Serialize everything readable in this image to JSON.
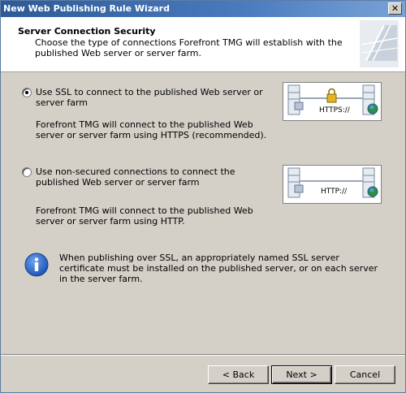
{
  "window": {
    "title": "New Web Publishing Rule Wizard",
    "close_glyph": "✕"
  },
  "header": {
    "title": "Server Connection Security",
    "description": "Choose the type of connections Forefront TMG will establish with the published Web server or server farm."
  },
  "options": [
    {
      "label": "Use SSL to connect to the published Web server or server farm",
      "description": "Forefront TMG will connect to the published Web server or server farm using HTTPS (recommended).",
      "checked": true,
      "protocol": "HTTPS://"
    },
    {
      "label": "Use non-secured connections to connect the published Web server or server farm",
      "description": "Forefront TMG will connect to the published Web server or server farm using HTTP.",
      "checked": false,
      "protocol": "HTTP://"
    }
  ],
  "info": {
    "icon": "info-icon",
    "text": "When publishing over SSL, an appropriately named SSL server certificate must be installed on the published server, or on each server in the server farm."
  },
  "buttons": {
    "back": "< Back",
    "next": "Next >",
    "cancel": "Cancel"
  },
  "colors": {
    "titlebar": "#2d5a96",
    "dialog_bg": "#d4d0c8",
    "info_blue": "#1c55b5"
  }
}
